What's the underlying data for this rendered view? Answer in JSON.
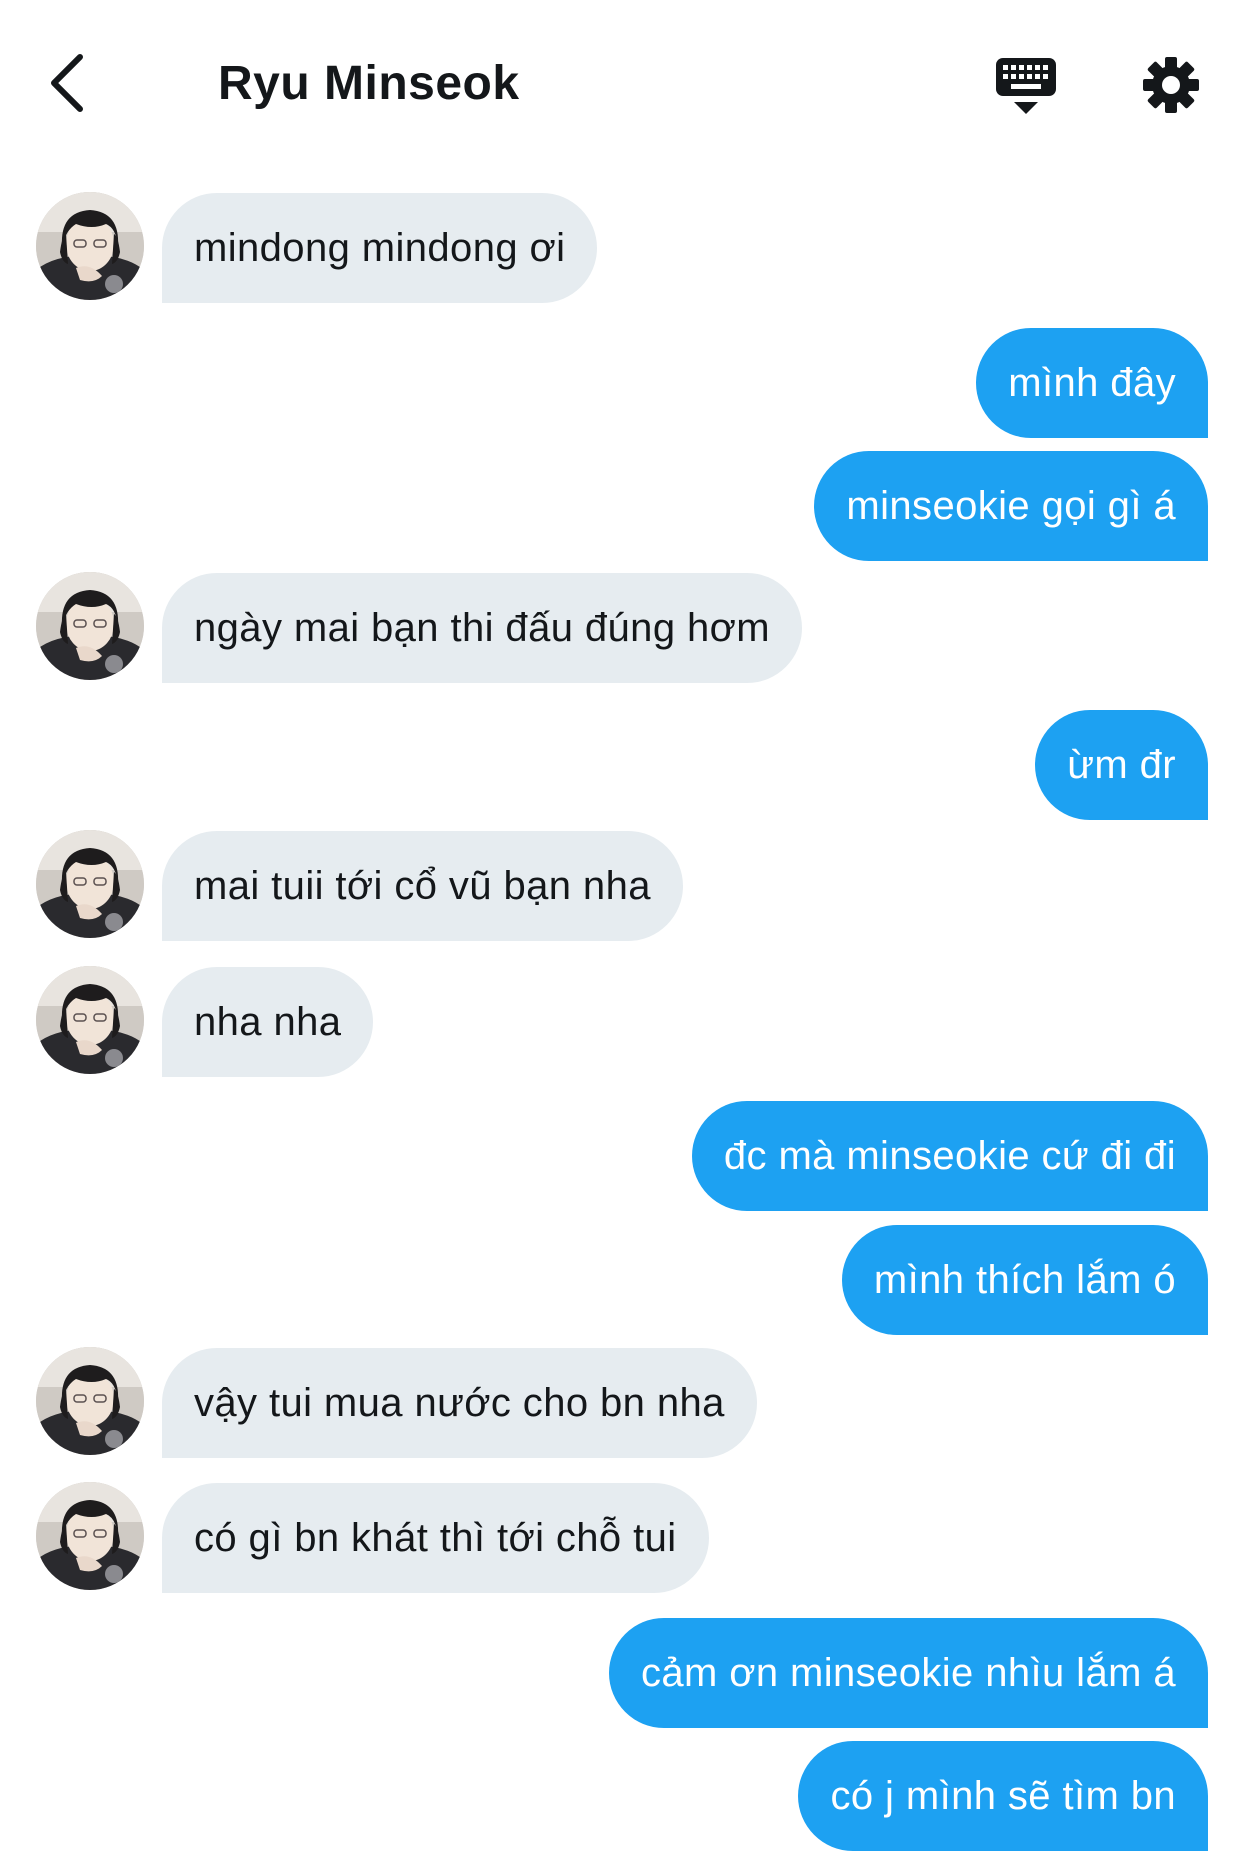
{
  "header": {
    "title": "Ryu Minseok"
  },
  "icons": {
    "back": "chevron-left-icon",
    "keyboard": "keyboard-icon",
    "settings": "gear-icon"
  },
  "colors": {
    "incoming_bubble": "#e6ecf0",
    "outgoing_bubble": "#1da1f2",
    "incoming_text": "#14171a",
    "outgoing_text": "#ffffff"
  },
  "messages": [
    {
      "from": "them",
      "text": "mindong mindong ơi"
    },
    {
      "from": "me",
      "text": "mình đây"
    },
    {
      "from": "me",
      "text": "minseokie gọi gì á"
    },
    {
      "from": "them",
      "text": "ngày mai bạn thi đấu đúng hơm"
    },
    {
      "from": "me",
      "text": "ừm đr"
    },
    {
      "from": "them",
      "text": "mai tuii tới cổ vũ bạn nha"
    },
    {
      "from": "them",
      "text": "nha nha"
    },
    {
      "from": "me",
      "text": "đc mà minseokie cứ đi đi"
    },
    {
      "from": "me",
      "text": "mình thích lắm ó"
    },
    {
      "from": "them",
      "text": "vậy tui mua nước cho bn nha"
    },
    {
      "from": "them",
      "text": "có gì bn khát thì tới chỗ tui"
    },
    {
      "from": "me",
      "text": "cảm ơn minseokie nhìu lắm á"
    },
    {
      "from": "me",
      "text": "có j mình sẽ tìm bn"
    }
  ]
}
